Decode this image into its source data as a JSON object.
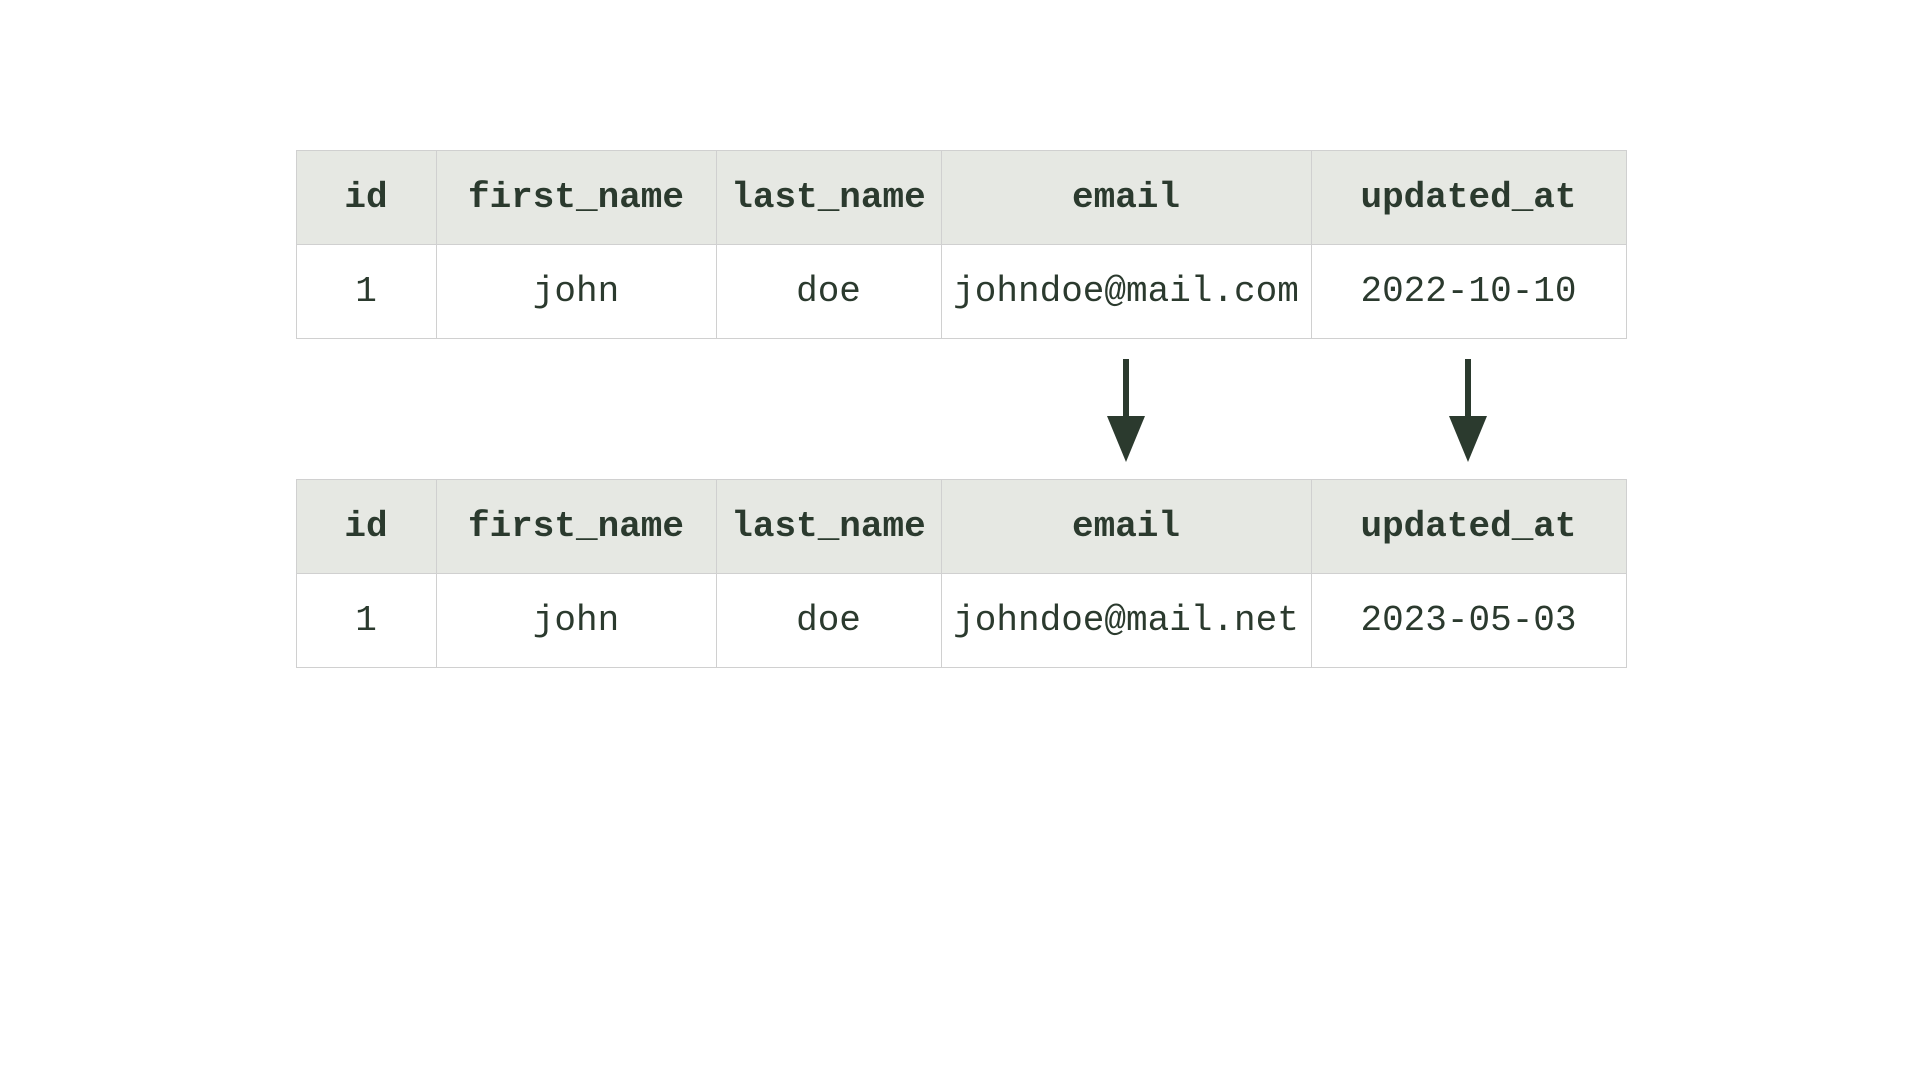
{
  "colors": {
    "header_bg": "#e6e8e3",
    "text": "#2b3a2e",
    "arrow": "#2b3a2e",
    "border": "#d0d0d0"
  },
  "columns": {
    "id": "id",
    "first_name": "first_name",
    "last_name": "last_name",
    "email": "email",
    "updated_at": "updated_at"
  },
  "table_before": {
    "row": {
      "id": "1",
      "first_name": "john",
      "last_name": "doe",
      "email": "johndoe@mail.com",
      "updated_at": "2022-10-10"
    }
  },
  "table_after": {
    "row": {
      "id": "1",
      "first_name": "john",
      "last_name": "doe",
      "email": "johndoe@mail.net",
      "updated_at": "2023-05-03"
    }
  }
}
